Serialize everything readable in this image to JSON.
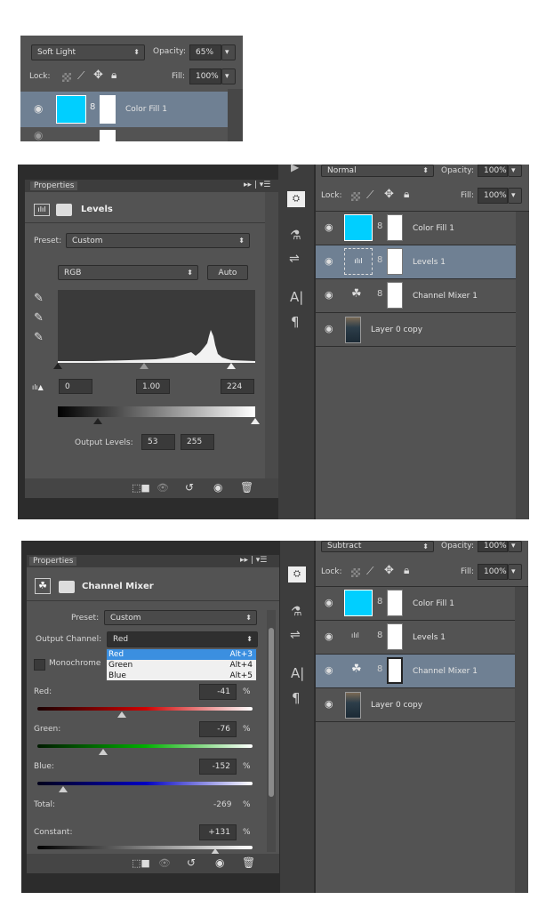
{
  "top_panel": {
    "blend_mode": "Soft Light",
    "opacity_label": "Opacity:",
    "opacity_value": "65%",
    "lock_label": "Lock:",
    "fill_label": "Fill:",
    "fill_value": "100%",
    "layer_name": "Color Fill 1"
  },
  "levels_screen": {
    "properties_tab": "Properties",
    "title": "Levels",
    "preset_label": "Preset:",
    "preset_value": "Custom",
    "channel_value": "RGB",
    "auto_button": "Auto",
    "input_black": "0",
    "input_gamma": "1.00",
    "input_white": "224",
    "output_label": "Output Levels:",
    "output_black": "53",
    "output_white": "255",
    "layers": {
      "blend_mode": "Normal",
      "opacity_label": "Opacity:",
      "opacity_value": "100%",
      "lock_label": "Lock:",
      "fill_label": "Fill:",
      "fill_value": "100%",
      "items": [
        "Color Fill 1",
        "Levels 1",
        "Channel Mixer 1",
        "Layer 0 copy"
      ]
    }
  },
  "mixer_screen": {
    "properties_tab": "Properties",
    "title": "Channel Mixer",
    "preset_label": "Preset:",
    "preset_value": "Custom",
    "output_channel_label": "Output Channel:",
    "output_channel_value": "Red",
    "monochrome_label": "Monochrome",
    "menu": [
      {
        "label": "Red",
        "shortcut": "Alt+3"
      },
      {
        "label": "Green",
        "shortcut": "Alt+4"
      },
      {
        "label": "Blue",
        "shortcut": "Alt+5"
      }
    ],
    "red_label": "Red:",
    "red_value": "-41",
    "green_label": "Green:",
    "green_value": "-76",
    "blue_label": "Blue:",
    "blue_value": "-152",
    "total_label": "Total:",
    "total_value": "-269",
    "constant_label": "Constant:",
    "constant_value": "+131",
    "percent": "%",
    "layers": {
      "blend_mode": "Subtract",
      "opacity_label": "Opacity:",
      "opacity_value": "100%",
      "lock_label": "Lock:",
      "fill_label": "Fill:",
      "fill_value": "100%",
      "items": [
        "Color Fill 1",
        "Levels 1",
        "Channel Mixer 1",
        "Layer 0 copy"
      ]
    }
  },
  "colors": {
    "accent_cyan": "#00cfff",
    "selected_row": "#6f8093",
    "menu_highlight": "#3b8fe0"
  }
}
